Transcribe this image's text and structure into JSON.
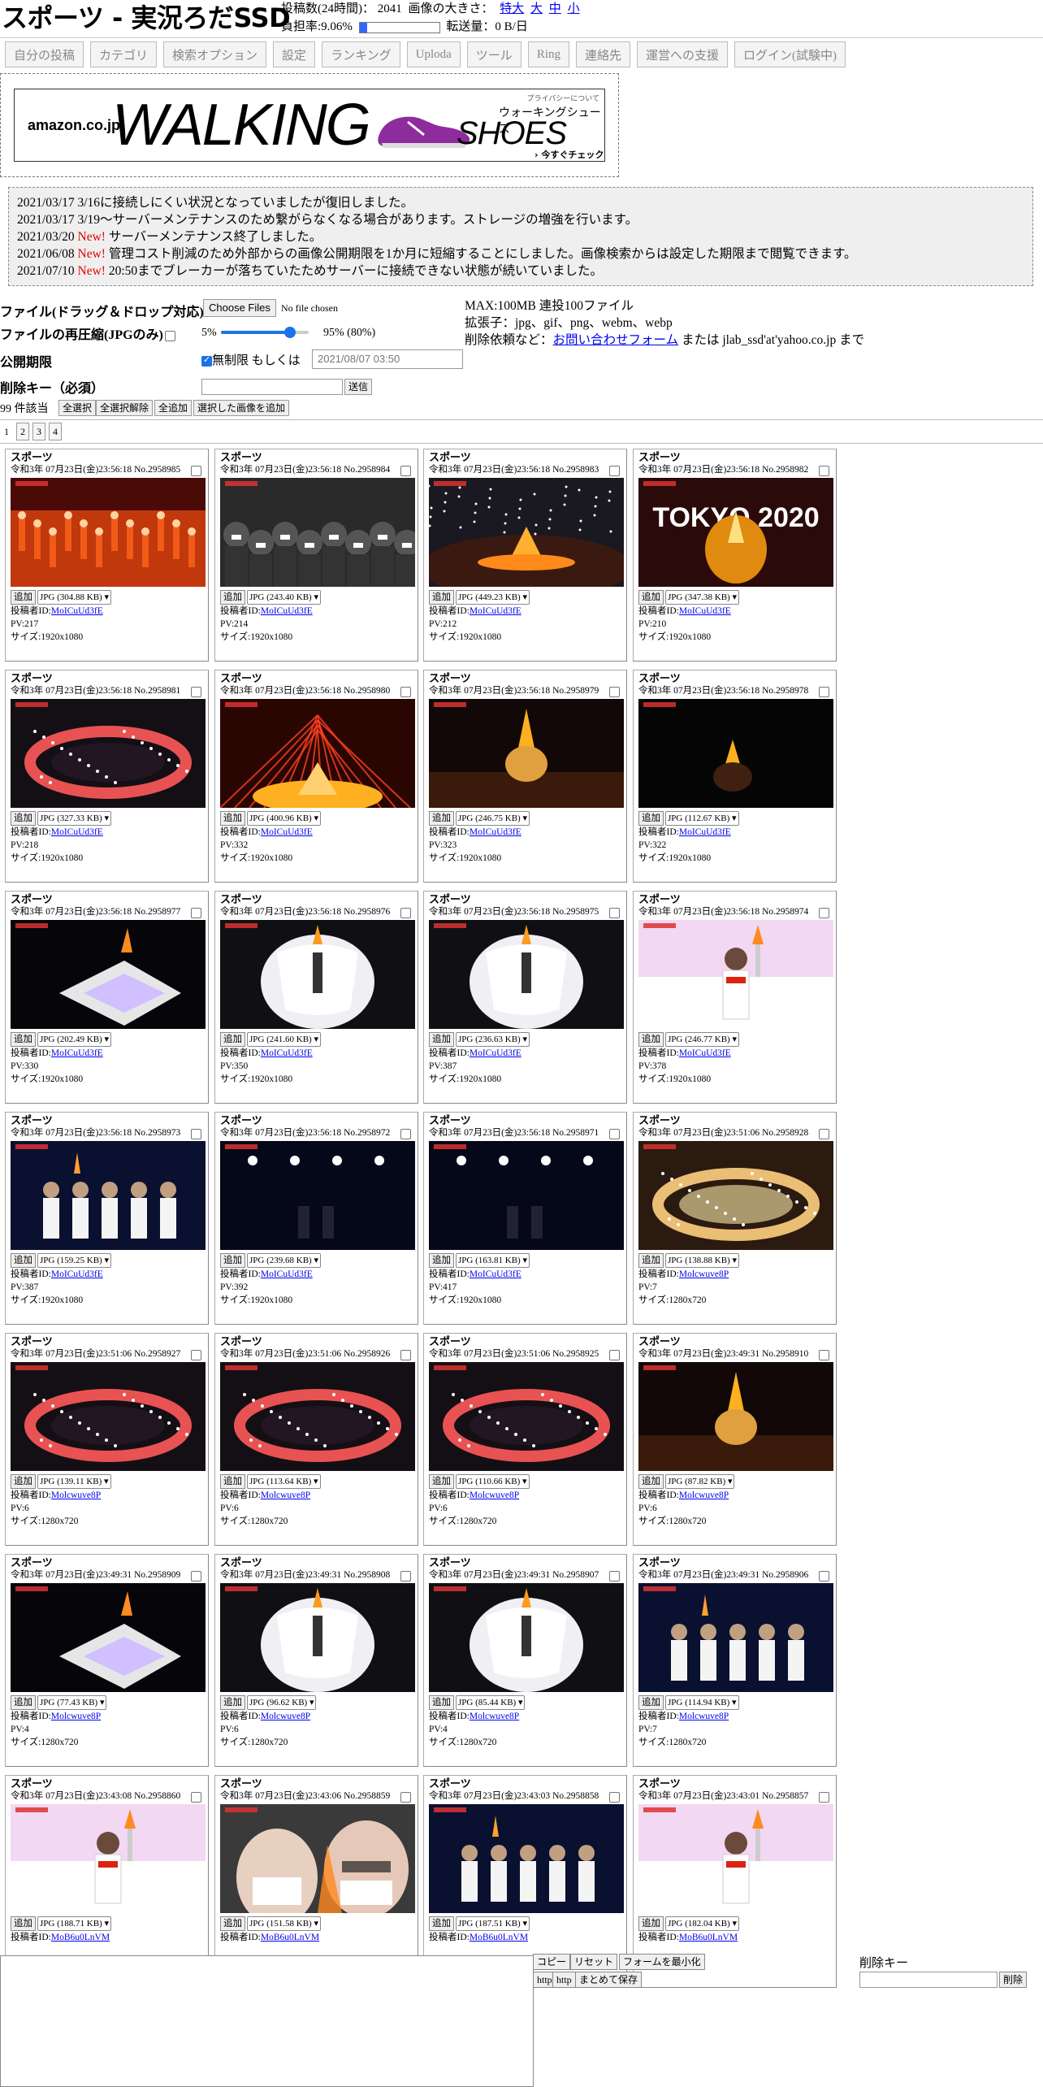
{
  "header": {
    "title": "スポーツ - 実況ろだSSD",
    "posts_label": "投稿数(24時間)：",
    "posts_value": "2041",
    "image_size_label": "画像の大きさ：",
    "size_links": [
      "特大",
      "大",
      "中",
      "小"
    ],
    "load_label": "負担率:9.06%",
    "load_fraction": 0.0906,
    "transfer_label": "転送量：0 B/日"
  },
  "nav": [
    "自分の投稿",
    "カテゴリ",
    "検索オプション",
    "設定",
    "ランキング",
    "Uploda",
    "ツール",
    "Ring",
    "連絡先",
    "運営への支援",
    "ログイン(試験中)"
  ],
  "ad": {
    "brand": "amazon.co.jp",
    "headline": "WALKING",
    "jp_text": "ウォーキングシューズ",
    "shoes": "SHOES",
    "cta": "› 今すぐチェック",
    "privacy": "プライバシーについて"
  },
  "notices": [
    {
      "date": "2021/03/17",
      "new": "",
      "text": "3/16に接続しにくい状況となっていましたが復旧しました。"
    },
    {
      "date": "2021/03/17",
      "new": "",
      "text": "3/19～サーバーメンテナンスのため繋がらなくなる場合があります。ストレージの増強を行います。"
    },
    {
      "date": "2021/03/20",
      "new": "New!",
      "text": "サーバーメンテナンス終了しました。"
    },
    {
      "date": "2021/06/08",
      "new": "New!",
      "text": "管理コスト削減のため外部からの画像公開期限を1か月に短縮することにしました。画像検索からは設定した期限まで閲覧できます。"
    },
    {
      "date": "2021/07/10",
      "new": "New!",
      "text": "20:50までブレーカーが落ちていたためサーバーに接続できない状態が続いていました。"
    }
  ],
  "form": {
    "file_label": "ファイル(ドラッグ＆ドロップ対応)",
    "file_button": "Choose Files",
    "file_chosen": "No file chosen",
    "recompress_label": "ファイルの再圧縮(JPGのみ)",
    "slider_min": "5%",
    "slider_max": "95% (80%)",
    "slider_value": 80,
    "expire_label": "公開期限",
    "unlimited_label": "無制限",
    "or_label": "もしくは",
    "expire_value": "2021/08/07 03:50",
    "delkey_label": "削除キー（必須）",
    "send_button": "送信",
    "max_info": "MAX:100MB 連投100ファイル",
    "ext_info": "拡張子：jpg、gif、png、webm、webp",
    "delete_prefix": "削除依頼など：",
    "contact_link": "お問い合わせフォーム",
    "delete_suffix": "または jlab_ssd'at'yahoo.co.jp まで"
  },
  "results": {
    "count": "99 件該当",
    "buttons": [
      "全選択",
      "全選択解除",
      "全追加",
      "選択した画像を追加"
    ]
  },
  "pages": [
    "1",
    "2",
    "3",
    "4"
  ],
  "cards": [
    {
      "cat": "スポーツ",
      "date": "令和3年 07月23日(金)23:56:18",
      "no": "No.2958985",
      "size": "JPG (304.88 KB)",
      "poster": "MoICuUd3fE",
      "pv": "PV:217",
      "res": "サイズ:1920x1080",
      "scene": "parade"
    },
    {
      "cat": "スポーツ",
      "date": "令和3年 07月23日(金)23:56:18",
      "no": "No.2958984",
      "size": "JPG (243.40 KB)",
      "poster": "MoICuUd3fE",
      "pv": "PV:214",
      "res": "サイズ:1920x1080",
      "scene": "crowd"
    },
    {
      "cat": "スポーツ",
      "date": "令和3年 07月23日(金)23:56:18",
      "no": "No.2958983",
      "size": "JPG (449.23 KB)",
      "poster": "MoICuUd3fE",
      "pv": "PV:212",
      "res": "サイズ:1920x1080",
      "scene": "stadium"
    },
    {
      "cat": "スポーツ",
      "date": "令和3年 07月23日(金)23:56:18",
      "no": "No.2958982",
      "size": "JPG (347.38 KB)",
      "poster": "MoICuUd3fE",
      "pv": "PV:210",
      "res": "サイズ:1920x1080",
      "scene": "tokyo",
      "overlay": "TOKYO 2020"
    },
    {
      "cat": "スポーツ",
      "date": "令和3年 07月23日(金)23:56:18",
      "no": "No.2958981",
      "size": "JPG (327.33 KB)",
      "poster": "MoICuUd3fE",
      "pv": "PV:218",
      "res": "サイズ:1920x1080",
      "scene": "ring"
    },
    {
      "cat": "スポーツ",
      "date": "令和3年 07月23日(金)23:56:18",
      "no": "No.2958980",
      "size": "JPG (400.96 KB)",
      "poster": "MoICuUd3fE",
      "pv": "PV:332",
      "res": "サイズ:1920x1080",
      "scene": "fire"
    },
    {
      "cat": "スポーツ",
      "date": "令和3年 07月23日(金)23:56:18",
      "no": "No.2958979",
      "size": "JPG (246.75 KB)",
      "poster": "MoICuUd3fE",
      "pv": "PV:323",
      "res": "サイズ:1920x1080",
      "scene": "cauldron"
    },
    {
      "cat": "スポーツ",
      "date": "令和3年 07月23日(金)23:56:18",
      "no": "No.2958978",
      "size": "JPG (112.67 KB)",
      "poster": "MoICuUd3fE",
      "pv": "PV:322",
      "res": "サイズ:1920x1080",
      "scene": "dark"
    },
    {
      "cat": "スポーツ",
      "date": "令和3年 07月23日(金)23:56:18",
      "no": "No.2958977",
      "size": "JPG (202.49 KB)",
      "poster": "MoICuUd3fE",
      "pv": "PV:330",
      "res": "サイズ:1920x1080",
      "scene": "stage"
    },
    {
      "cat": "スポーツ",
      "date": "令和3年 07月23日(金)23:56:18",
      "no": "No.2958976",
      "size": "JPG (241.60 KB)",
      "poster": "MoICuUd3fE",
      "pv": "PV:350",
      "res": "サイズ:1920x1080",
      "scene": "sphere"
    },
    {
      "cat": "スポーツ",
      "date": "令和3年 07月23日(金)23:56:18",
      "no": "No.2958975",
      "size": "JPG (236.63 KB)",
      "poster": "MoICuUd3fE",
      "pv": "PV:387",
      "res": "サイズ:1920x1080",
      "scene": "sphere"
    },
    {
      "cat": "スポーツ",
      "date": "令和3年 07月23日(金)23:56:18",
      "no": "No.2958974",
      "size": "JPG (246.77 KB)",
      "poster": "MoICuUd3fE",
      "pv": "PV:378",
      "res": "サイズ:1920x1080",
      "scene": "torch"
    },
    {
      "cat": "スポーツ",
      "date": "令和3年 07月23日(金)23:56:18",
      "no": "No.2958973",
      "size": "JPG (159.25 KB)",
      "poster": "MoICuUd3fE",
      "pv": "PV:387",
      "res": "サイズ:1920x1080",
      "scene": "people"
    },
    {
      "cat": "スポーツ",
      "date": "令和3年 07月23日(金)23:56:18",
      "no": "No.2958972",
      "size": "JPG (239.68 KB)",
      "poster": "MoICuUd3fE",
      "pv": "PV:392",
      "res": "サイズ:1920x1080",
      "scene": "night"
    },
    {
      "cat": "スポーツ",
      "date": "令和3年 07月23日(金)23:56:18",
      "no": "No.2958971",
      "size": "JPG (163.81 KB)",
      "poster": "MoICuUd3fE",
      "pv": "PV:417",
      "res": "サイズ:1920x1080",
      "scene": "night"
    },
    {
      "cat": "スポーツ",
      "date": "令和3年 07月23日(金)23:51:06",
      "no": "No.2958928",
      "size": "JPG (138.88 KB)",
      "poster": "Molcwuve8P",
      "pv": "PV:7",
      "res": "サイズ:1280x720",
      "scene": "glow"
    },
    {
      "cat": "スポーツ",
      "date": "令和3年 07月23日(金)23:51:06",
      "no": "No.2958927",
      "size": "JPG (139.11 KB)",
      "poster": "Molcwuve8P",
      "pv": "PV:6",
      "res": "サイズ:1280x720",
      "scene": "ring"
    },
    {
      "cat": "スポーツ",
      "date": "令和3年 07月23日(金)23:51:06",
      "no": "No.2958926",
      "size": "JPG (113.64 KB)",
      "poster": "Molcwuve8P",
      "pv": "PV:6",
      "res": "サイズ:1280x720",
      "scene": "ring"
    },
    {
      "cat": "スポーツ",
      "date": "令和3年 07月23日(金)23:51:06",
      "no": "No.2958925",
      "size": "JPG (110.66 KB)",
      "poster": "Molcwuve8P",
      "pv": "PV:6",
      "res": "サイズ:1280x720",
      "scene": "ring"
    },
    {
      "cat": "スポーツ",
      "date": "令和3年 07月23日(金)23:49:31",
      "no": "No.2958910",
      "size": "JPG (87.82 KB)",
      "poster": "Molcwuve8P",
      "pv": "PV:6",
      "res": "サイズ:1280x720",
      "scene": "cauldron"
    },
    {
      "cat": "スポーツ",
      "date": "令和3年 07月23日(金)23:49:31",
      "no": "No.2958909",
      "size": "JPG (77.43 KB)",
      "poster": "Molcwuve8P",
      "pv": "PV:4",
      "res": "サイズ:1280x720",
      "scene": "stage"
    },
    {
      "cat": "スポーツ",
      "date": "令和3年 07月23日(金)23:49:31",
      "no": "No.2958908",
      "size": "JPG (96.62 KB)",
      "poster": "Molcwuve8P",
      "pv": "PV:6",
      "res": "サイズ:1280x720",
      "scene": "sphere"
    },
    {
      "cat": "スポーツ",
      "date": "令和3年 07月23日(金)23:49:31",
      "no": "No.2958907",
      "size": "JPG (85.44 KB)",
      "poster": "Molcwuve8P",
      "pv": "PV:4",
      "res": "サイズ:1280x720",
      "scene": "sphere"
    },
    {
      "cat": "スポーツ",
      "date": "令和3年 07月23日(金)23:49:31",
      "no": "No.2958906",
      "size": "JPG (114.94 KB)",
      "poster": "Molcwuve8P",
      "pv": "PV:7",
      "res": "サイズ:1280x720",
      "scene": "people"
    },
    {
      "cat": "スポーツ",
      "date": "令和3年 07月23日(金)23:43:08",
      "no": "No.2958860",
      "size": "JPG (188.71 KB)",
      "poster": "MoB6u0LnVM",
      "pv": "",
      "res": "",
      "scene": "torch"
    },
    {
      "cat": "スポーツ",
      "date": "令和3年 07月23日(金)23:43:06",
      "no": "No.2958859",
      "size": "JPG (151.58 KB)",
      "poster": "MoB6u0LnVM",
      "pv": "",
      "res": "",
      "scene": "closeup"
    },
    {
      "cat": "スポーツ",
      "date": "令和3年 07月23日(金)23:43:03",
      "no": "No.2958858",
      "size": "JPG (187.51 KB)",
      "poster": "MoB6u0LnVM",
      "pv": "",
      "res": "",
      "scene": "people"
    },
    {
      "cat": "スポーツ",
      "date": "令和3年 07月23日(金)23:43:01",
      "no": "No.2958857",
      "size": "JPG (182.04 KB)",
      "poster": "MoB6u0LnVM",
      "pv": "",
      "res": "",
      "scene": "torch"
    }
  ],
  "card_labels": {
    "add": "追加",
    "poster_prefix": "投稿者ID:"
  },
  "bottom": {
    "buttons": [
      "コピー",
      "リセット",
      "フォームを最小化"
    ],
    "buttons2": [
      "http",
      "http",
      "まとめて保存"
    ],
    "delkey_label": "削除キー",
    "delete_button": "削除"
  },
  "colors": {
    "new": "#e00000",
    "link": "#0000ee",
    "load_fill": "#3366ff"
  }
}
